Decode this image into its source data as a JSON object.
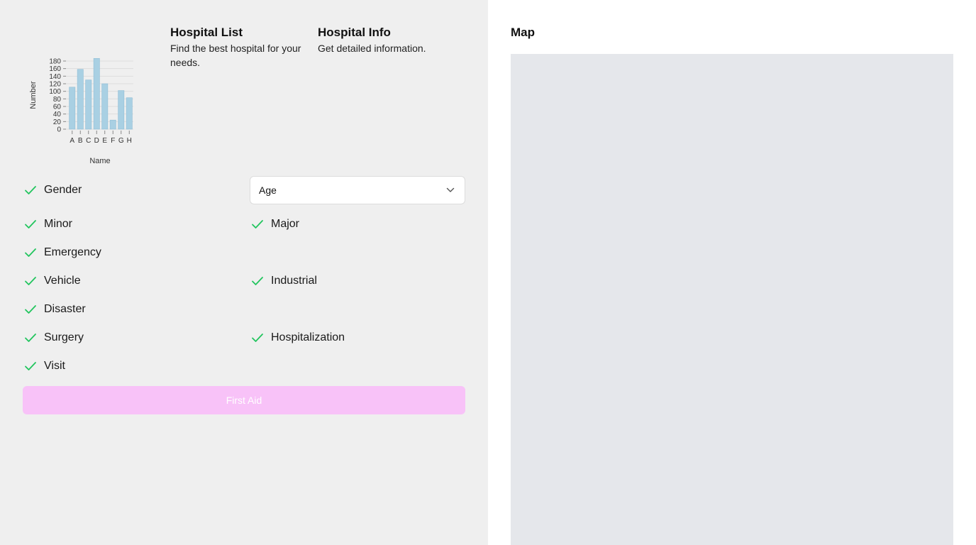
{
  "chart": {
    "chart_data": {
      "type": "bar",
      "categories": [
        "A",
        "B",
        "C",
        "D",
        "E",
        "F",
        "G",
        "H"
      ],
      "values": [
        111,
        158,
        130,
        187,
        120,
        24,
        102,
        83
      ],
      "title": "",
      "xlabel": "Name",
      "ylabel": "Number",
      "ylim": [
        0,
        180
      ],
      "yticks": [
        "0",
        "20",
        "40",
        "60",
        "80",
        "100",
        "120",
        "140",
        "160",
        "180"
      ],
      "grid": true,
      "bar_color": "#a9d0e3"
    }
  },
  "hospital_list": {
    "title": "Hospital List",
    "description": "Find the best hospital for your needs."
  },
  "hospital_info": {
    "title": "Hospital Info",
    "description": "Get detailed information."
  },
  "filters": {
    "gender": "Gender",
    "age_select": {
      "value": "Age"
    },
    "minor": "Minor",
    "major": "Major",
    "emergency": "Emergency",
    "vehicle": "Vehicle",
    "industrial": "Industrial",
    "disaster": "Disaster",
    "surgery": "Surgery",
    "hospitalization": "Hospitalization",
    "visit": "Visit"
  },
  "first_aid_button": {
    "label": "First Aid"
  },
  "map": {
    "title": "Map"
  },
  "colors": {
    "check": "#22c55e",
    "button": "#f8c2f8",
    "map_bg": "#e5e7eb",
    "panel_bg": "#efefef"
  }
}
